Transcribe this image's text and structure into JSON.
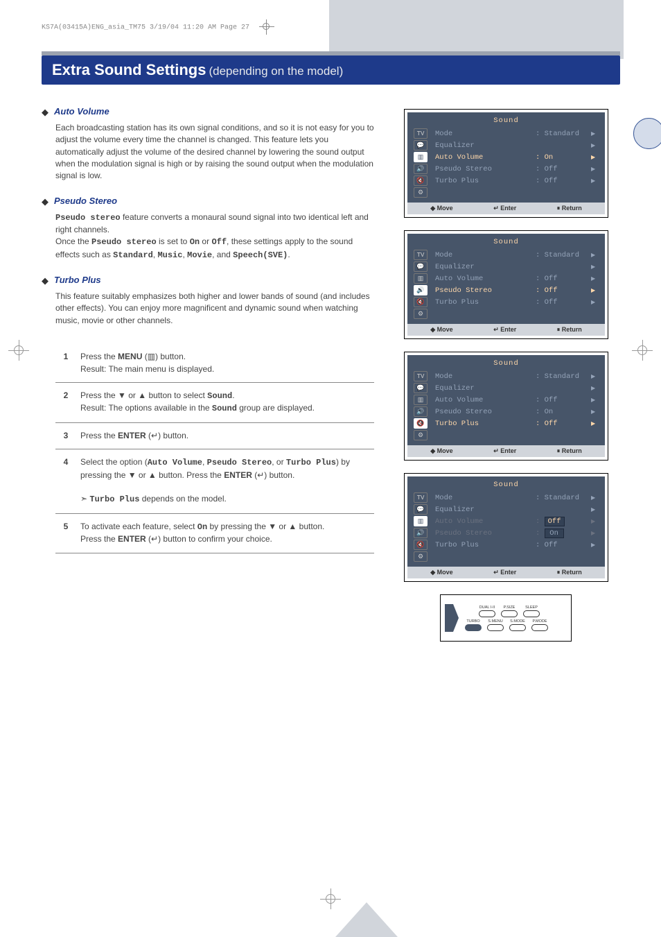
{
  "header": "KS7A(03415A)ENG_asia_TM75  3/19/04  11:20 AM  Page 27",
  "title_main": "Extra Sound Settings",
  "title_sub": "(depending on the model)",
  "sections": [
    {
      "title": "Auto Volume",
      "body": "Each broadcasting station has its own signal conditions, and so it is not easy for you to adjust the volume every time the channel is changed. This feature lets you automatically adjust the volume of the desired channel by lowering the sound output when the modulation signal is high or by raising the sound output when the modulation signal is low."
    },
    {
      "title": "Pseudo Stereo",
      "body_parts": [
        {
          "pre": "",
          "mono": "Pseudo stereo",
          "post": " feature converts a monaural sound signal into two identical left and right channels."
        },
        {
          "pre": "Once the ",
          "mono": "Pseudo stereo",
          "post": " is set to "
        },
        {
          "mono": "On",
          "post": " or "
        },
        {
          "mono": "Off",
          "post": ", these settings apply to the sound effects such as "
        },
        {
          "mono": "Standard",
          "post": ", "
        },
        {
          "mono": "Music",
          "post": ", "
        },
        {
          "mono": "Movie",
          "post": ", and "
        },
        {
          "mono": "Speech(SVE)",
          "post": "."
        }
      ]
    },
    {
      "title": "Turbo Plus",
      "body": "This feature suitably emphasizes both higher and lower bands of sound (and includes other effects). You can enjoy more magnificent and dynamic sound when watching music, movie or other channels."
    }
  ],
  "panels": [
    {
      "title": "Sound",
      "hi": 2,
      "rows": [
        {
          "icon": "TV",
          "label": "Mode",
          "val": ": Standard",
          "arr": "▶"
        },
        {
          "icon": "💬",
          "label": "Equalizer",
          "val": "",
          "arr": "▶"
        },
        {
          "icon": "▥",
          "label": "Auto Volume",
          "val": ": On",
          "arr": "▶",
          "highlight": true
        },
        {
          "icon": "🔊",
          "label": "Pseudo Stereo",
          "val": ": Off",
          "arr": "▶"
        },
        {
          "icon": "🔇",
          "label": "Turbo Plus",
          "val": ": Off",
          "arr": "▶"
        },
        {
          "icon": "⚙",
          "label": "",
          "val": "",
          "arr": ""
        }
      ],
      "foot": [
        "◆ Move",
        "↵ Enter",
        "⏸ Return"
      ]
    },
    {
      "title": "Sound",
      "hi": 3,
      "rows": [
        {
          "icon": "TV",
          "label": "Mode",
          "val": ": Standard",
          "arr": "▶"
        },
        {
          "icon": "💬",
          "label": "Equalizer",
          "val": "",
          "arr": "▶"
        },
        {
          "icon": "▥",
          "label": "Auto Volume",
          "val": ": Off",
          "arr": "▶"
        },
        {
          "icon": "🔊",
          "label": "Pseudo Stereo",
          "val": ": Off",
          "arr": "▶",
          "highlight": true
        },
        {
          "icon": "🔇",
          "label": "Turbo Plus",
          "val": ": Off",
          "arr": "▶"
        },
        {
          "icon": "⚙",
          "label": "",
          "val": "",
          "arr": ""
        }
      ],
      "foot": [
        "◆ Move",
        "↵ Enter",
        "⏸ Return"
      ]
    },
    {
      "title": "Sound",
      "hi": 4,
      "rows": [
        {
          "icon": "TV",
          "label": "Mode",
          "val": ": Standard",
          "arr": "▶"
        },
        {
          "icon": "💬",
          "label": "Equalizer",
          "val": "",
          "arr": "▶"
        },
        {
          "icon": "▥",
          "label": "Auto Volume",
          "val": ": Off",
          "arr": "▶"
        },
        {
          "icon": "🔊",
          "label": "Pseudo Stereo",
          "val": ": On",
          "arr": "▶"
        },
        {
          "icon": "🔇",
          "label": "Turbo Plus",
          "val": ": Off",
          "arr": "▶",
          "highlight": true
        },
        {
          "icon": "⚙",
          "label": "",
          "val": "",
          "arr": ""
        }
      ],
      "foot": [
        "◆ Move",
        "↵ Enter",
        "⏸ Return"
      ]
    },
    {
      "title": "Sound",
      "hi_box": 2,
      "rows": [
        {
          "icon": "TV",
          "label": "Mode",
          "val": ": Standard",
          "arr": "▶"
        },
        {
          "icon": "💬",
          "label": "Equalizer",
          "val": "",
          "arr": "▶"
        },
        {
          "icon": "▥",
          "label": "Auto Volume",
          "val": "Off",
          "arr": "▶",
          "dim": true,
          "box": true,
          "highlight": true
        },
        {
          "icon": "🔊",
          "label": "Pseudo Stereo",
          "val": "On",
          "arr": "▶",
          "dim": true,
          "box2": true
        },
        {
          "icon": "🔇",
          "label": "Turbo Plus",
          "val": ": Off",
          "arr": "▶"
        },
        {
          "icon": "⚙",
          "label": "",
          "val": "",
          "arr": ""
        }
      ],
      "foot": [
        "◆ Move",
        "↵ Enter",
        "⏸ Return"
      ]
    }
  ],
  "steps": [
    {
      "n": "1",
      "body": "Press the <b>MENU</b> (▥) button.<br>Result: The main menu is displayed."
    },
    {
      "n": "2",
      "body": "Press the ▼ or ▲ button to select <span class='mono'>Sound</span>.<br>Result: The options available in the <span class='mono'>Sound</span> group are displayed."
    },
    {
      "n": "3",
      "body": "Press the <b>ENTER</b> (↵) button."
    },
    {
      "n": "4",
      "body": "Select the option (<span class='mono'>Auto Volume</span>, <span class='mono'>Pseudo Stereo</span>, or <span class='mono'>Turbo Plus</span>) by pressing the ▼ or ▲ button. Press the <b>ENTER</b> (↵) button.<br><br>➣ <span class='mono'>Turbo Plus</span> depends on the model."
    },
    {
      "n": "5",
      "body": "To activate each feature, select <span class='mono'>On</span> by pressing the ▼ or ▲ button.<br>Press the <b>ENTER</b> (↵) button to confirm your choice."
    }
  ],
  "remote_labels": {
    "row1": [
      "DUAL I-II",
      "P.SIZE",
      "SLEEP"
    ],
    "row2": [
      "TURBO",
      "S.MENU",
      "S.MODE",
      "P.MODE"
    ]
  },
  "icons": {
    "menu": "▥",
    "enter": "↵",
    "up": "▲",
    "down": "▼",
    "right": "▶",
    "send": "➣",
    "move": "◆",
    "pause": "⏸"
  }
}
